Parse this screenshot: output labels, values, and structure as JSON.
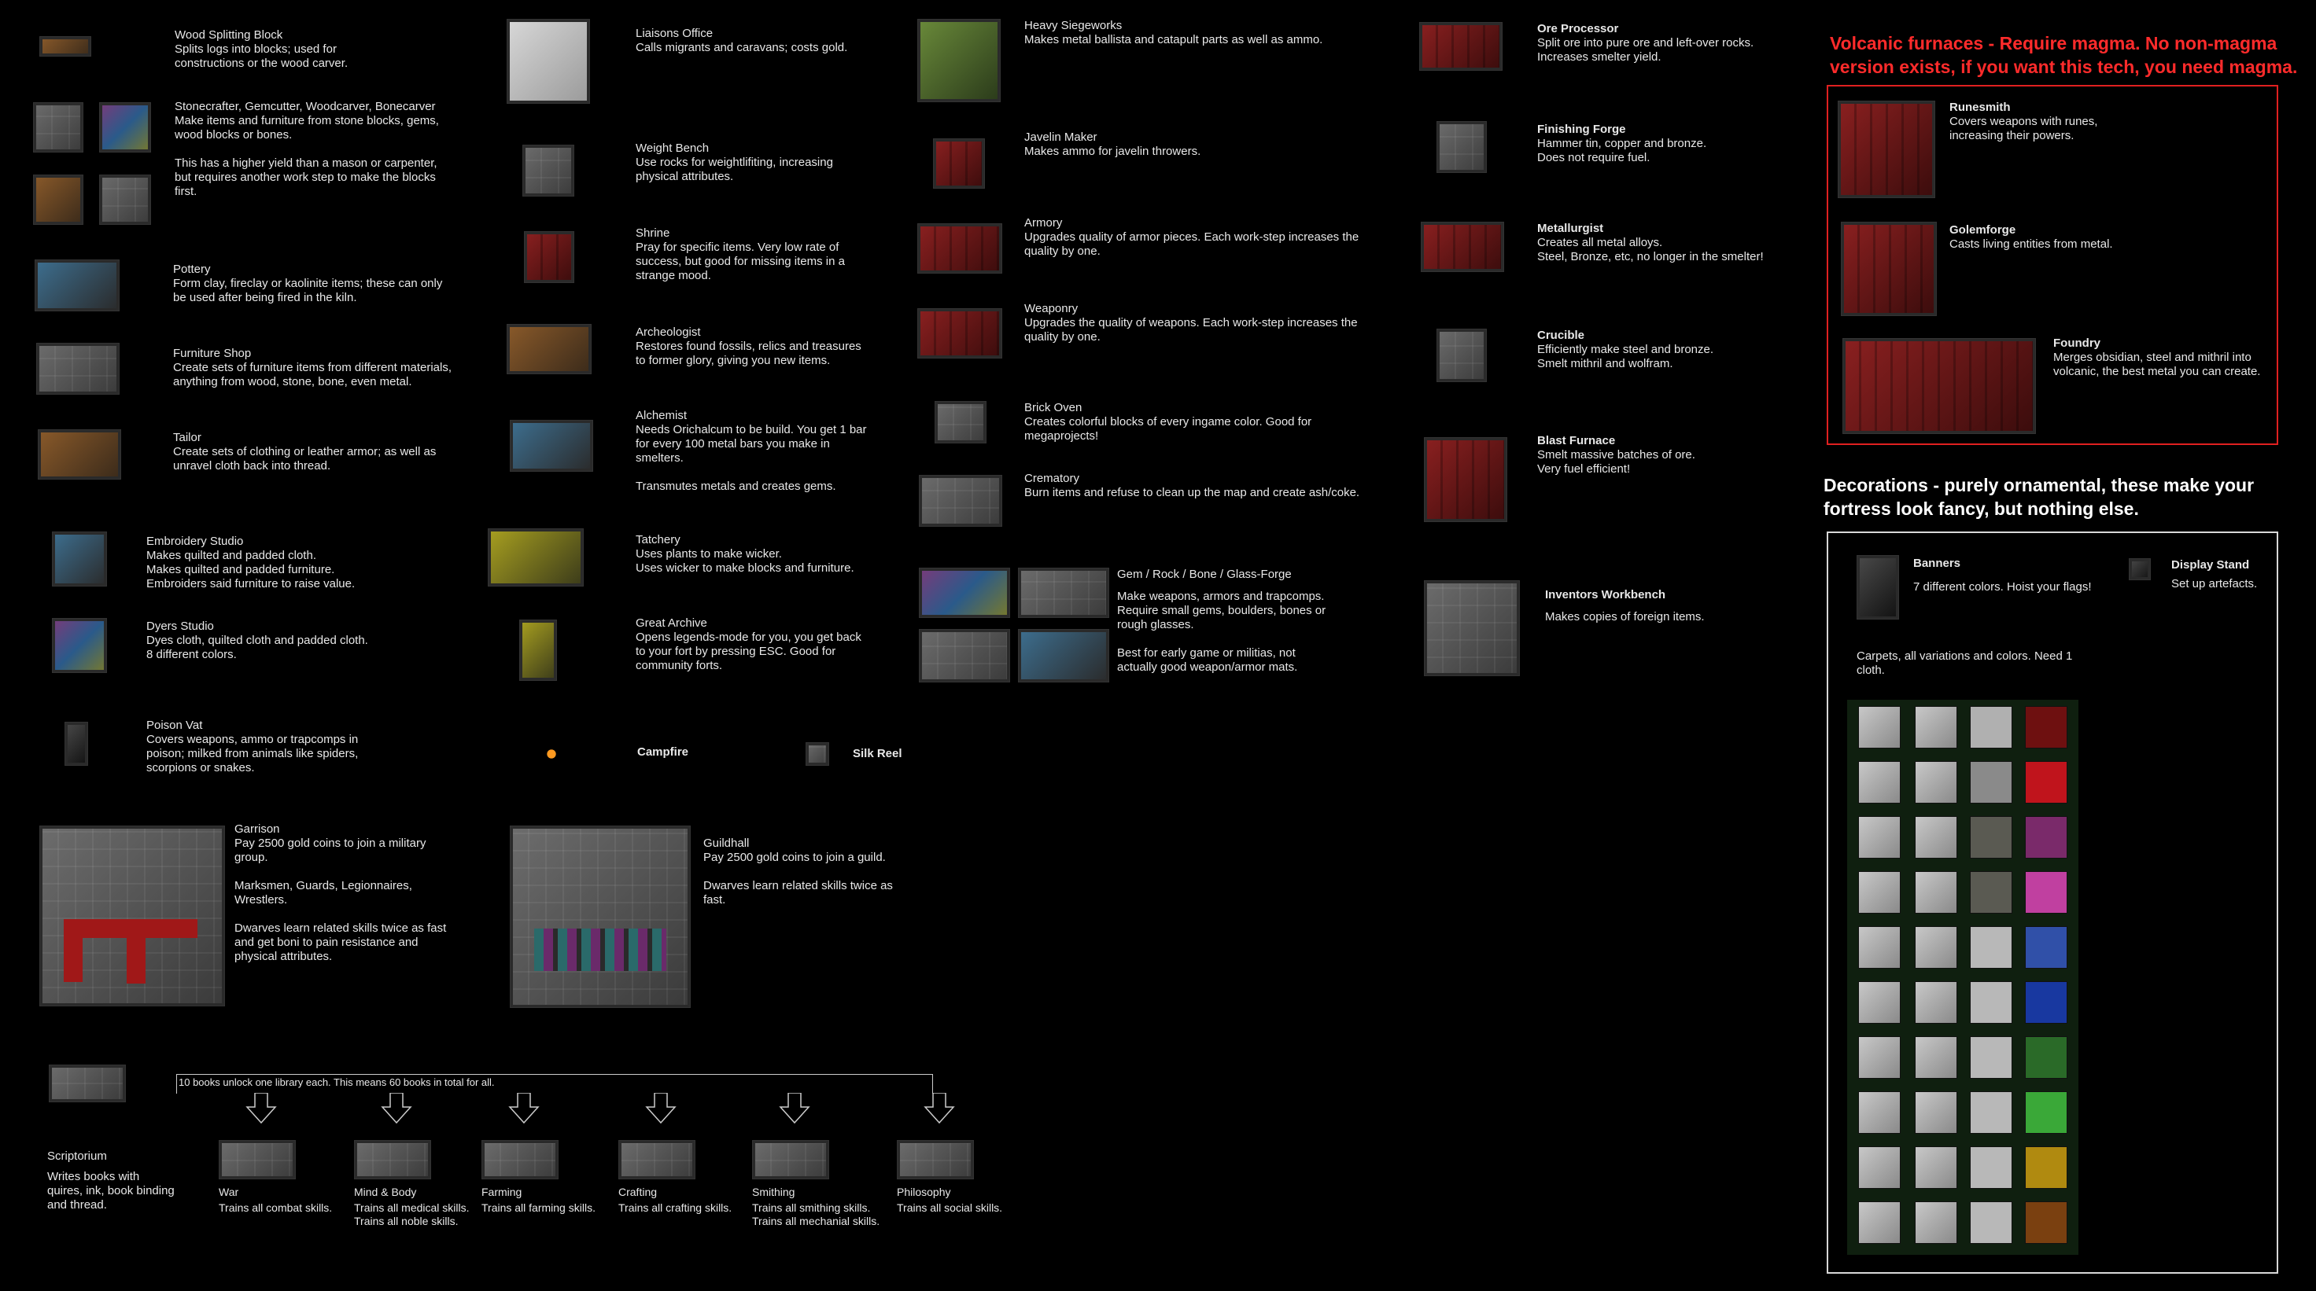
{
  "left_column": [
    {
      "title": "Wood Splitting Block",
      "desc": "Splits logs into blocks; used for\nconstructions or the wood carver."
    },
    {
      "title": "Stonecrafter, Gemcutter, Woodcarver, Bonecarver",
      "desc": "Make items and furniture from stone blocks, gems,\nwood blocks or bones.\n\nThis has a higher yield than a mason or carpenter,\nbut requires another work step to make the blocks\nfirst."
    },
    {
      "title": "Pottery",
      "desc": "Form clay, fireclay or kaolinite items; these can only\nbe used after being fired in the kiln."
    },
    {
      "title": "Furniture Shop",
      "desc": "Create sets of furniture items from different materials,\nanything from wood, stone, bone, even metal."
    },
    {
      "title": "Tailor",
      "desc": "Create sets of clothing or leather armor; as well as\nunravel cloth back into thread."
    },
    {
      "title": "Embroidery Studio",
      "desc": "Makes quilted and padded cloth.\nMakes quilted and padded furniture.\nEmbroiders said furniture to raise value."
    },
    {
      "title": "Dyers Studio",
      "desc": "Dyes cloth, quilted cloth and padded cloth.\n8 different colors."
    },
    {
      "title": "Poison Vat",
      "desc": "Covers weapons, ammo or trapcomps in\npoison; milked from animals like spiders,\nscorpions or snakes."
    },
    {
      "title": "Garrison",
      "desc": "Pay 2500 gold coins to join a military\ngroup.\n\nMarksmen, Guards, Legionnaires,\nWrestlers.\n\nDwarves learn related skills twice as fast\nand get boni to pain resistance and\nphysical attributes."
    }
  ],
  "middle_column": [
    {
      "title": "Liaisons Office",
      "desc": "Calls migrants and caravans; costs gold."
    },
    {
      "title": "Weight Bench",
      "desc": "Use rocks for weightlifiting, increasing\nphysical attributes."
    },
    {
      "title": "Shrine",
      "desc": "Pray for specific items. Very low rate of\nsuccess, but good for missing items in a\nstrange mood."
    },
    {
      "title": "Archeologist",
      "desc": "Restores found fossils, relics and treasures\nto former glory, giving you new items."
    },
    {
      "title": "Alchemist",
      "desc": "Needs Orichalcum to be build. You get 1 bar\nfor every 100 metal bars you make in\nsmelters.\n\nTransmutes metals and creates gems."
    },
    {
      "title": "Tatchery",
      "desc": "Uses plants to make wicker.\nUses wicker to make blocks and furniture."
    },
    {
      "title": "Great Archive",
      "desc": "Opens legends-mode for you, you get back\nto your fort by pressing ESC. Good for\ncommunity forts."
    },
    {
      "title": "Campfire",
      "desc": ""
    },
    {
      "title": "Silk Reel",
      "desc": ""
    },
    {
      "title": "Guildhall",
      "desc": "Pay 2500 gold coins to join a guild.\n\nDwarves learn related skills twice as\nfast."
    }
  ],
  "third_column": [
    {
      "title": "Heavy Siegeworks",
      "desc": "Makes metal ballista and catapult parts as well as ammo."
    },
    {
      "title": "Javelin Maker",
      "desc": "Makes ammo for javelin throwers."
    },
    {
      "title": "Armory",
      "desc": "Upgrades quality of armor pieces. Each work-step increases the\nquality by one."
    },
    {
      "title": "Weaponry",
      "desc": "Upgrades the quality of weapons. Each work-step increases the\nquality by one."
    },
    {
      "title": "Brick Oven",
      "desc": "Creates colorful blocks of every ingame color. Good for\nmegaprojects!"
    },
    {
      "title": "Crematory",
      "desc": "Burn items and refuse to clean up the map and create ash/coke."
    },
    {
      "title": "Gem / Rock / Bone / Glass-Forge",
      "desc": "Make weapons, armors and trapcomps.\nRequire small gems, boulders, bones or\nrough glasses.\n\nBest for early game or militias, not\nactually good weapon/armor mats."
    }
  ],
  "fourth_column": [
    {
      "title": "Ore Processor",
      "desc": "Split ore into pure ore and left-over rocks.\nIncreases smelter yield."
    },
    {
      "title": "Finishing Forge",
      "desc": "Hammer tin, copper and bronze.\nDoes not require fuel."
    },
    {
      "title": "Metallurgist",
      "desc": "Creates all metal alloys.\nSteel, Bronze, etc, no longer in the smelter!"
    },
    {
      "title": "Crucible",
      "desc": "Efficiently make steel and bronze.\nSmelt mithril and wolfram."
    },
    {
      "title": "Blast Furnace",
      "desc": "Smelt massive batches of ore.\nVery fuel efficient!"
    },
    {
      "title": "Inventors Workbench",
      "desc": "Makes copies of foreign items."
    }
  ],
  "volcanic": {
    "heading": "Volcanic furnaces - Require magma. No non-magma\nversion exists, if you want this tech, you need magma.",
    "color": "#ff2b2b",
    "items": [
      {
        "title": "Runesmith",
        "desc": "Covers weapons with runes,\nincreasing their powers."
      },
      {
        "title": "Golemforge",
        "desc": "Casts living entities from metal."
      },
      {
        "title": "Foundry",
        "desc": "Merges obsidian, steel and mithril into\nvolcanic, the best metal you can create."
      }
    ]
  },
  "decorations": {
    "heading": "Decorations - purely ornamental, these make your\nfortress look fancy, but nothing else.",
    "banners": {
      "title": "Banners",
      "desc": "7 different colors. Hoist your flags!"
    },
    "display": {
      "title": "Display Stand",
      "desc": "Set up artefacts."
    },
    "carpets": "Carpets, all variations and colors. Need 1\ncloth.",
    "carpet_colors": [
      "#6e1010",
      "#c0141c",
      "#7a2a6a",
      "#c040a0",
      "#3050a8",
      "#1838a0",
      "#2a6a28",
      "#3aa838",
      "#b08a10",
      "#7a4010"
    ]
  },
  "scriptorium": {
    "title": "Scriptorium",
    "desc": "Writes books with\nquires, ink, book binding\nand thread.",
    "note": "10 books unlock one library each. This means 60 books in total for all.",
    "libraries": [
      {
        "name": "War",
        "desc": "Trains all combat skills."
      },
      {
        "name": "Mind & Body",
        "desc": "Trains all medical skills.\nTrains all noble skills."
      },
      {
        "name": "Farming",
        "desc": "Trains all farming skills."
      },
      {
        "name": "Crafting",
        "desc": "Trains all crafting skills."
      },
      {
        "name": "Smithing",
        "desc": "Trains all smithing skills.\nTrains all mechanial skills."
      },
      {
        "name": "Philosophy",
        "desc": "Trains all social skills."
      }
    ]
  }
}
